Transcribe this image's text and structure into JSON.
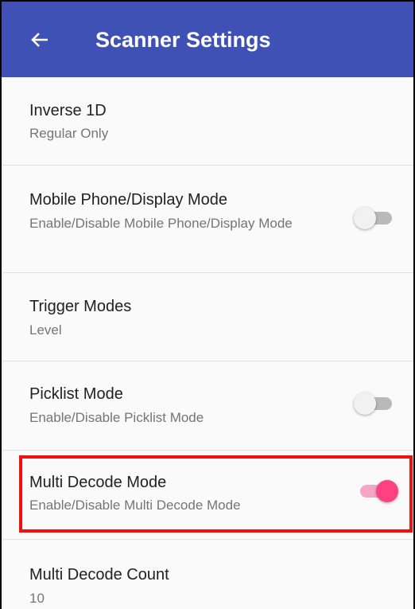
{
  "appbar": {
    "title": "Scanner Settings",
    "back_icon": "arrow-back-icon",
    "color": "#3f51b5"
  },
  "settings": [
    {
      "title": "Inverse 1D",
      "summary": "Regular Only"
    },
    {
      "title": "Mobile Phone/Display Mode",
      "summary": "Enable/Disable Mobile Phone/Display Mode",
      "toggle": false
    },
    {
      "title": "Trigger Modes",
      "summary": "Level"
    },
    {
      "title": "Picklist Mode",
      "summary": "Enable/Disable Picklist Mode",
      "toggle": false
    },
    {
      "title": "Multi Decode Mode",
      "summary": "Enable/Disable Multi Decode Mode",
      "toggle": true,
      "highlighted": true
    },
    {
      "title": "Multi Decode Count",
      "summary": "10"
    }
  ],
  "colors": {
    "accent": "#ff4081",
    "highlight_border": "#ee1111"
  }
}
